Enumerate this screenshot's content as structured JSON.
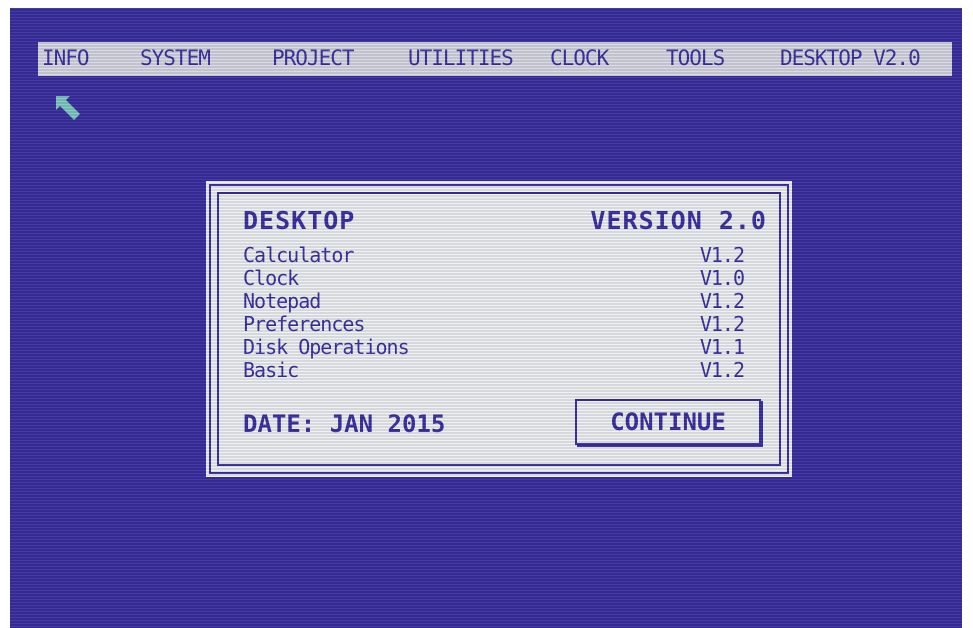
{
  "menu": [
    {
      "label": "INFO"
    },
    {
      "label": "SYSTEM"
    },
    {
      "label": "PROJECT"
    },
    {
      "label": "UTILITIES"
    },
    {
      "label": "CLOCK"
    },
    {
      "label": "TOOLS"
    },
    {
      "label": "DESKTOP V2.0"
    }
  ],
  "cursor_icon": "arrow-pointer-icon",
  "dialog": {
    "title": "DESKTOP",
    "version": "VERSION 2.0",
    "items": [
      {
        "name": "Calculator",
        "version": "V1.2"
      },
      {
        "name": "Clock",
        "version": "V1.0"
      },
      {
        "name": "Notepad",
        "version": "V1.2"
      },
      {
        "name": "Preferences",
        "version": "V1.2"
      },
      {
        "name": "Disk Operations",
        "version": "V1.1"
      },
      {
        "name": "Basic",
        "version": "V1.2"
      }
    ],
    "date": "DATE: JAN 2015",
    "continue_label": "CONTINUE"
  },
  "colors": {
    "background": "#3a2fa0",
    "menubar": "#d8d8e4",
    "dialog": "#eef0f4",
    "cursor": "#7fc9c2"
  }
}
